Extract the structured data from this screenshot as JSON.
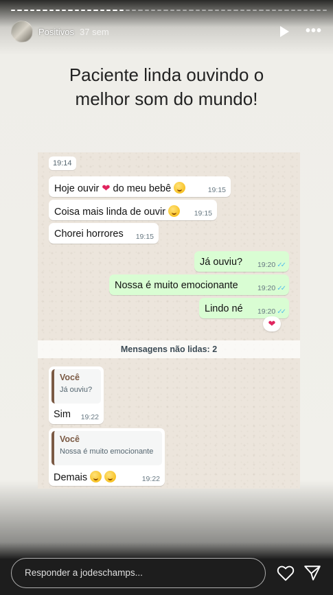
{
  "story": {
    "author": "Positivos",
    "time_ago": "37 sem",
    "caption": "Paciente linda ouvindo o melhor som do mundo!",
    "reply_placeholder": "Responder a jodeschamps..."
  },
  "chat": {
    "date_chip": "19:14",
    "incoming": [
      {
        "text": "Hoje ouvir",
        "heart": "❤",
        "text2": "do meu bebê",
        "time": "19:15"
      },
      {
        "text": "Coisa mais linda de ouvir",
        "time": "19:15"
      },
      {
        "text": "Chorei horrores",
        "time": "19:15"
      }
    ],
    "outgoing": [
      {
        "text": "Já ouviu?",
        "time": "19:20",
        "ticks": "✓✓"
      },
      {
        "text": "Nossa é muito emocionante",
        "time": "19:20",
        "ticks": "✓✓"
      },
      {
        "text": "Lindo né",
        "time": "19:20",
        "ticks": "✓✓",
        "reaction": "❤"
      }
    ],
    "unread_divider": "Mensagens não lidas: 2",
    "replies": [
      {
        "quote_author": "Você",
        "quote_text": "Já ouviu?",
        "text": "Sim",
        "time": "19:22"
      },
      {
        "quote_author": "Você",
        "quote_text": "Nossa é muito emocionante",
        "text": "Demais",
        "time": "19:22"
      }
    ]
  }
}
